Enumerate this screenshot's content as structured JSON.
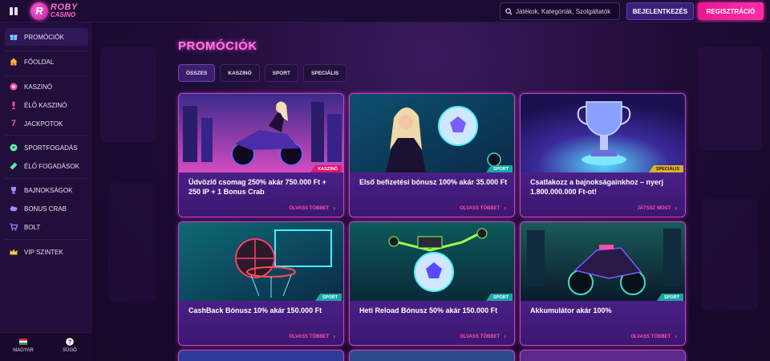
{
  "header": {
    "brand_line1": "ROBY",
    "brand_line2": "CASINO",
    "logo_letter": "R",
    "search_placeholder": "Játékok, Kategóriák, Szolgáltatók",
    "login_label": "BEJELENTKEZÉS",
    "register_label": "REGISZTRÁCIÓ"
  },
  "sidebar": {
    "items": [
      {
        "label": "PROMÓCIÓK",
        "icon": "gift-icon",
        "active": true
      },
      {
        "label": "FŐOLDAL",
        "icon": "home-icon"
      },
      {
        "label": "KASZINÓ",
        "icon": "chip-icon"
      },
      {
        "label": "ÉLŐ KASZINÓ",
        "icon": "microphone-icon"
      },
      {
        "label": "JACKPOTOK",
        "icon": "seven-icon"
      },
      {
        "label": "SPORTFOGADÁS",
        "icon": "soccer-ball-icon"
      },
      {
        "label": "ÉLŐ FOGADÁSOK",
        "icon": "ticket-icon"
      },
      {
        "label": "BAJNOKSÁGOK",
        "icon": "trophy-icon"
      },
      {
        "label": "BONUS CRAB",
        "icon": "crab-icon"
      },
      {
        "label": "BOLT",
        "icon": "cart-icon"
      },
      {
        "label": "VIP SZINTEK",
        "icon": "crown-icon"
      }
    ],
    "language_label": "MAGYAR",
    "help_label": "SÚGÓ"
  },
  "main": {
    "title": "PROMÓCIÓK",
    "tabs": [
      {
        "label": "ÖSSZES",
        "active": true
      },
      {
        "label": "KASZINÓ"
      },
      {
        "label": "SPORT"
      },
      {
        "label": "SPECIÁLIS"
      }
    ],
    "cards": [
      {
        "title": "Üdvözlő csomag 250% akár 750.000 Ft + 250 IP + 1 Bonus Crab",
        "badge": "KASZINÓ",
        "cta": "OLVASS TÖBBET",
        "image": "motorbike-rider"
      },
      {
        "title": "Első befizetési bónusz 100% akár 35.000 Ft",
        "badge": "SPORT",
        "cta": "OLVASS TÖBBET",
        "image": "woman-soccer-ball"
      },
      {
        "title": "Csatlakozz a bajnokságainkhoz – nyerj 1.800.000.000 Ft-ot!",
        "badge": "SPECIÁLIS",
        "cta": "JÁTSSZ MOST",
        "image": "trophy-cup"
      },
      {
        "title": "CashBack Bónusz 10% akár 150.000 Ft",
        "badge": "SPORT",
        "cta": "OLVASS TÖBBET",
        "image": "basketball-hoop"
      },
      {
        "title": "Heti Reload Bónusz 50% akár 150.000 Ft",
        "badge": "SPORT",
        "cta": "OLVASS TÖBBET",
        "image": "drone-soccer-ball"
      },
      {
        "title": "Akkumulátor akár 100%",
        "badge": "SPORT",
        "cta": "OLVASS TÖBBET",
        "image": "neon-motorbike"
      }
    ]
  },
  "colors": {
    "accent_pink": "#ff2ea8",
    "title_pink": "#ff7ae6",
    "card_border": "#c943c4",
    "card_body": "#3a1870",
    "badge_kaszino": "#e0156f",
    "badge_sport": "#18a7a7",
    "badge_special": "#d8b12c"
  }
}
